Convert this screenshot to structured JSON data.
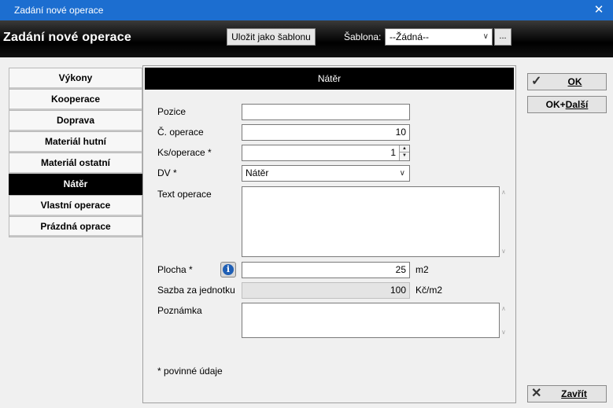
{
  "window": {
    "title": "Zadání nové operace",
    "close_glyph": "✕"
  },
  "header": {
    "title": "Zadání nové operace",
    "save_template_label": "Uložit jako šablonu",
    "template_label": "Šablona:",
    "template_value": "--Žádná--",
    "more_label": "..."
  },
  "tabs": [
    {
      "label": "Výkony"
    },
    {
      "label": "Kooperace"
    },
    {
      "label": "Doprava"
    },
    {
      "label": "Materiál hutní"
    },
    {
      "label": "Materiál ostatní"
    },
    {
      "label": "Nátěr",
      "active": true
    },
    {
      "label": "Vlastní operace"
    },
    {
      "label": "Prázdná oprace"
    }
  ],
  "panel": {
    "title": "Nátěr",
    "fields": {
      "position": {
        "label": "Pozice",
        "value": ""
      },
      "op_number": {
        "label": "Č. operace",
        "value": "10"
      },
      "qty_per_op": {
        "label": "Ks/operace *",
        "value": "1"
      },
      "dv": {
        "label": "DV *",
        "value": "Nátěr"
      },
      "op_text": {
        "label": "Text operace",
        "value": ""
      },
      "area": {
        "label": "Plocha *",
        "value": "25",
        "unit": "m2"
      },
      "unit_rate": {
        "label": "Sazba za jednotku",
        "value": "100",
        "unit": "Kč/m2"
      },
      "note": {
        "label": "Poznámka",
        "value": ""
      }
    },
    "required_note": "* povinné údaje"
  },
  "buttons": {
    "ok": "OK",
    "ok_next_prefix": "OK+",
    "ok_next_suffix": "Další",
    "close": "Zavřít"
  },
  "icons": {
    "ok": "checkmark-icon",
    "close": "x-icon",
    "info": "info-icon"
  }
}
